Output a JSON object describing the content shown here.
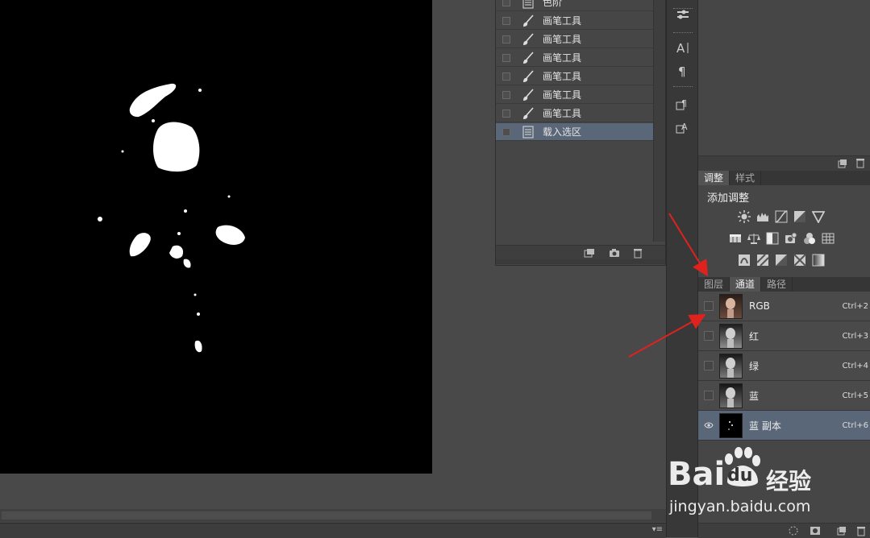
{
  "history": {
    "items": [
      {
        "label": "色阶",
        "icon": "document-icon",
        "active": false
      },
      {
        "label": "画笔工具",
        "icon": "brush-icon",
        "active": false
      },
      {
        "label": "画笔工具",
        "icon": "brush-icon",
        "active": false
      },
      {
        "label": "画笔工具",
        "icon": "brush-icon",
        "active": false
      },
      {
        "label": "画笔工具",
        "icon": "brush-icon",
        "active": false
      },
      {
        "label": "画笔工具",
        "icon": "brush-icon",
        "active": false
      },
      {
        "label": "画笔工具",
        "icon": "brush-icon",
        "active": false
      },
      {
        "label": "载入选区",
        "icon": "document-icon",
        "active": true
      }
    ]
  },
  "adjustments": {
    "tabs": [
      "调整",
      "样式"
    ],
    "title": "添加调整"
  },
  "layers_panel": {
    "tabs": [
      "图层",
      "通道",
      "路径"
    ],
    "active_tab": "通道"
  },
  "channels": [
    {
      "name": "RGB",
      "shortcut": "Ctrl+2",
      "visible": false,
      "active": false
    },
    {
      "name": "红",
      "shortcut": "Ctrl+3",
      "visible": false,
      "active": false
    },
    {
      "name": "绿",
      "shortcut": "Ctrl+4",
      "visible": false,
      "active": false
    },
    {
      "name": "蓝",
      "shortcut": "Ctrl+5",
      "visible": false,
      "active": false
    },
    {
      "name": "蓝 副本",
      "shortcut": "Ctrl+6",
      "visible": true,
      "active": true
    }
  ],
  "watermark": {
    "brand": "Bai",
    "brand2": "du",
    "sub": "经验",
    "url": "jingyan.baidu.com"
  },
  "colors": {
    "accent_arrow": "#e0221f",
    "selected_row": "#5a6778"
  }
}
